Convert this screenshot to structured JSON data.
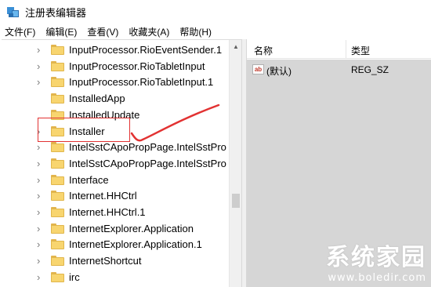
{
  "window": {
    "title": "注册表编辑器"
  },
  "menu": [
    "文件(F)",
    "编辑(E)",
    "查看(V)",
    "收藏夹(A)",
    "帮助(H)"
  ],
  "tree": {
    "nodes": [
      {
        "label": "InputProcessor.RioEventSender.1",
        "expandable": true
      },
      {
        "label": "InputProcessor.RioTabletInput",
        "expandable": true
      },
      {
        "label": "InputProcessor.RioTabletInput.1",
        "expandable": true
      },
      {
        "label": "InstalledApp",
        "expandable": false
      },
      {
        "label": "InstalledUpdate",
        "expandable": false
      },
      {
        "label": "Installer",
        "expandable": true,
        "highlighted": true
      },
      {
        "label": "IntelSstCApoPropPage.IntelSstPro",
        "expandable": true
      },
      {
        "label": "IntelSstCApoPropPage.IntelSstPro",
        "expandable": true
      },
      {
        "label": "Interface",
        "expandable": true
      },
      {
        "label": "Internet.HHCtrl",
        "expandable": true
      },
      {
        "label": "Internet.HHCtrl.1",
        "expandable": true
      },
      {
        "label": "InternetExplorer.Application",
        "expandable": true
      },
      {
        "label": "InternetExplorer.Application.1",
        "expandable": true
      },
      {
        "label": "InternetShortcut",
        "expandable": true
      },
      {
        "label": "irc",
        "expandable": true
      }
    ]
  },
  "values_list": {
    "columns": {
      "name": "名称",
      "type": "类型"
    },
    "rows": [
      {
        "name": "(默认)",
        "type": "REG_SZ",
        "icon": "ab-string-icon"
      }
    ]
  },
  "annotation": {
    "color": "#e23232"
  },
  "watermark": {
    "title": "系统家园",
    "url": "www.boledir.com"
  }
}
